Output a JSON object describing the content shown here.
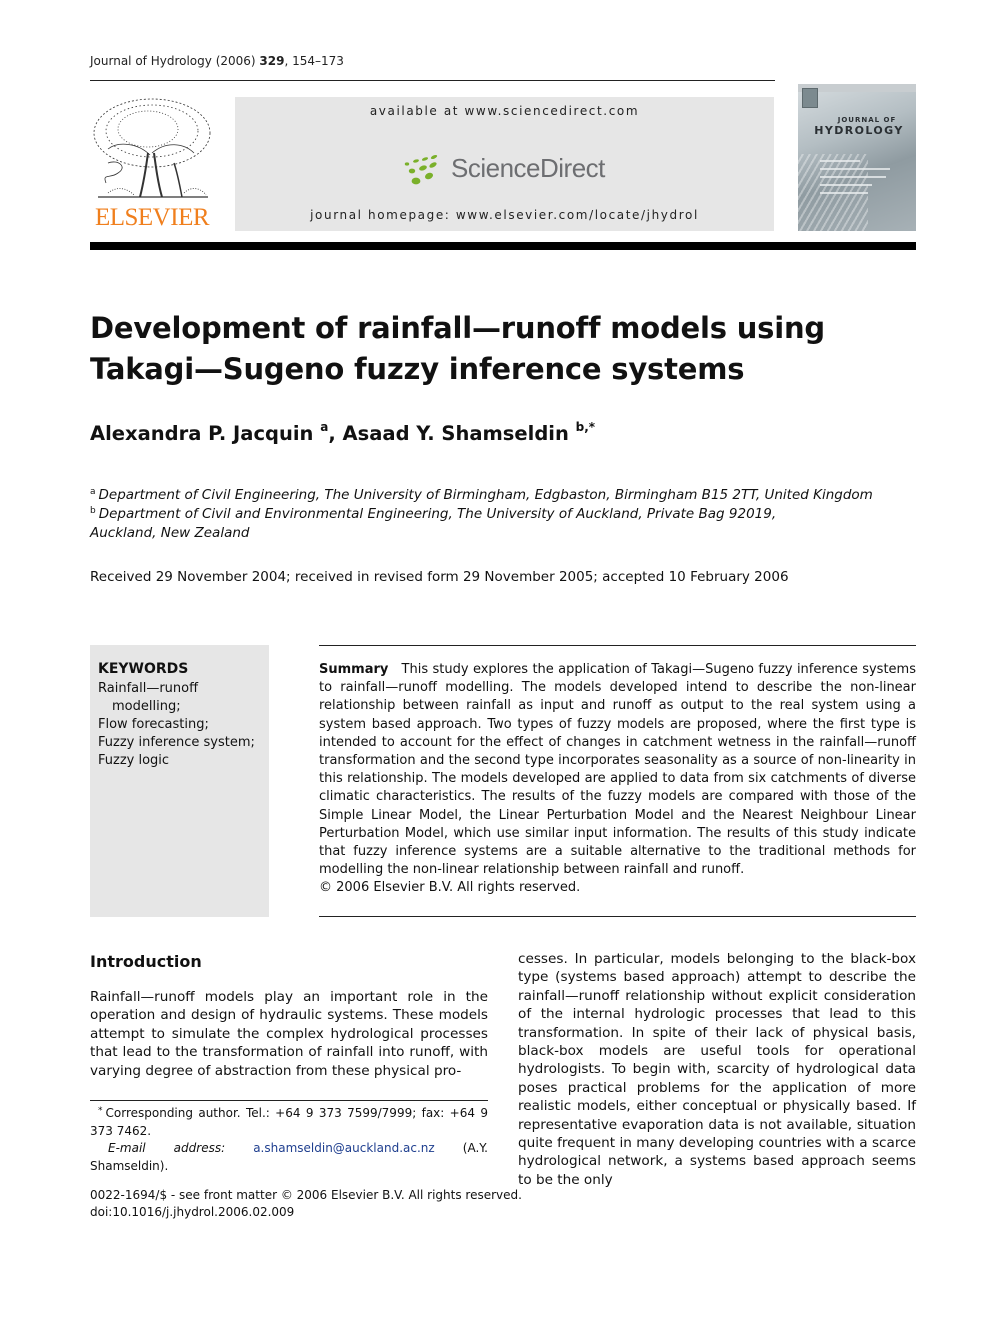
{
  "running_head": {
    "journal": "Journal of Hydrology",
    "year": "(2006)",
    "volume": "329",
    "pages": ", 154–173"
  },
  "masthead": {
    "available_at": "available at www.sciencedirect.com",
    "sciencedirect_logo": "ScienceDirect",
    "journal_homepage": "journal homepage: www.elsevier.com/locate/jhydrol",
    "publisher_logo": "ELSEVIER",
    "cover": {
      "line1": "JOURNAL OF",
      "line2": "HYDROLOGY"
    },
    "colors": {
      "elsevier_orange": "#f07f1d",
      "sciencedirect_green": "#7ab02a",
      "masthead_grey": "#e6e6e6"
    }
  },
  "article": {
    "title": "Development of rainfall—runoff models using Takagi—Sugeno fuzzy inference systems",
    "authors": [
      {
        "name": "Alexandra P. Jacquin",
        "affil": "a"
      },
      {
        "name": "Asaad Y. Shamseldin",
        "affil": "b,*"
      }
    ],
    "affiliations": [
      {
        "mark": "a",
        "text": "Department of Civil Engineering, The University of Birmingham, Edgbaston, Birmingham B15 2TT, United Kingdom"
      },
      {
        "mark": "b",
        "text": "Department of Civil and Environmental Engineering, The University of Auckland, Private Bag 92019,",
        "text2": "Auckland, New Zealand"
      }
    ],
    "received": "Received 29 November 2004; received in revised form 29 November 2005; accepted 10 February 2006"
  },
  "keywords": {
    "heading": "KEYWORDS",
    "items": [
      "Rainfall—runoff",
      "  modelling;",
      "Flow forecasting;",
      "Fuzzy inference system;",
      "Fuzzy logic"
    ]
  },
  "abstract": {
    "label": "Summary",
    "text": "This study explores the application of Takagi—Sugeno fuzzy inference systems to rainfall—runoff modelling. The models developed intend to describe the non-linear relationship between rainfall as input and runoff as output to the real system using a system based approach. Two types of fuzzy models are proposed, where the first type is intended to account for the effect of changes in catchment wetness in the rainfall—runoff transformation and the second type incorporates seasonality as a source of non-linearity in this relationship. The models developed are applied to data from six catchments of diverse climatic characteristics. The results of the fuzzy models are compared with those of the Simple Linear Model, the Linear Perturbation Model and the Nearest Neighbour Linear Perturbation Model, which use similar input information. The results of this study indicate that fuzzy inference systems are a suitable alternative to the traditional methods for modelling the non-linear relationship between rainfall and runoff.",
    "copyright": "© 2006 Elsevier B.V. All rights reserved."
  },
  "body": {
    "section_heading": "Introduction",
    "left_column": "Rainfall—runoff models play an important role in the operation and design of hydraulic systems. These models attempt to simulate the complex hydrological processes that lead to the transformation of rainfall into runoff, with varying degree of abstraction from these physical pro-",
    "right_column": "cesses. In particular, models belonging to the black-box type (systems based approach) attempt to describe the rainfall—runoff relationship without explicit consideration of the internal hydrologic processes that lead to this transformation. In spite of their lack of physical basis, black-box models are useful tools for operational hydrologists. To begin with, scarcity of hydrological data poses practical problems for the application of more realistic models, either conceptual or physically based. If representative evaporation data is not available, situation quite frequent in many developing countries with a scarce hydrological network, a systems based approach seems to be the only"
  },
  "footnote": {
    "star": "*",
    "corresponding": "Corresponding author. Tel.: +64 9 373 7599/7999; fax: +64 9 373 7462.",
    "email_label": "E-mail address:",
    "email": "a.shamseldin@auckland.ac.nz",
    "email_suffix": "(A.Y. Shamseldin)."
  },
  "front_matter": {
    "issn": "0022-1694/$ - see front matter  © 2006 Elsevier B.V. All rights reserved.",
    "doi": "doi:10.1016/j.jhydrol.2006.02.009"
  }
}
